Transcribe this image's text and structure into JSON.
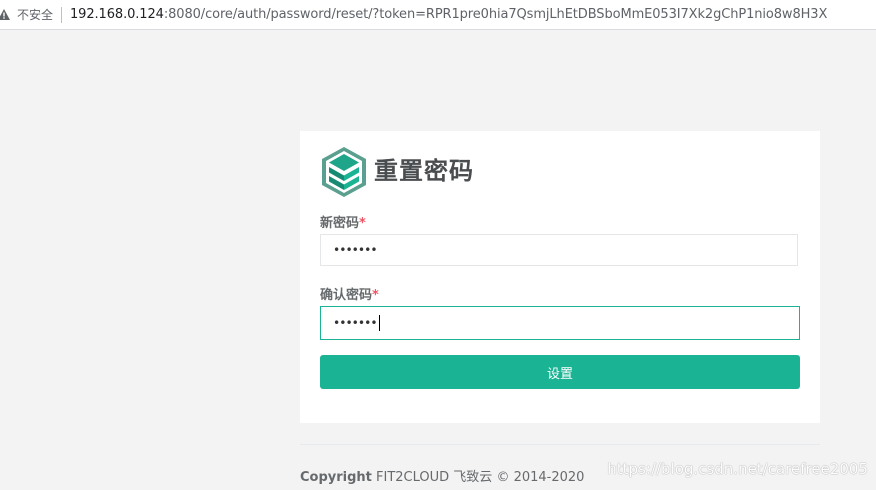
{
  "browser": {
    "security_label": "不安全",
    "url_host": "192.168.0.124",
    "url_rest": ":8080/core/auth/password/reset/?token=RPR1pre0hia7QsmjLhEtDBSboMmE053I7Xk2gChP1nio8w8H3X"
  },
  "form": {
    "title": "重置密码",
    "new_password_label": "新密码",
    "confirm_password_label": "确认密码",
    "required_mark": "*",
    "new_password_value": "•••••••",
    "confirm_password_value": "•••••••",
    "submit_label": "设置"
  },
  "footer": {
    "copyright_bold": "Copyright",
    "copyright_rest": " FIT2CLOUD 飞致云 © 2014-2020"
  },
  "watermark": "https://blog.csdn.net/carefree2005",
  "colors": {
    "accent": "#1ab394",
    "required": "#ed5565"
  }
}
